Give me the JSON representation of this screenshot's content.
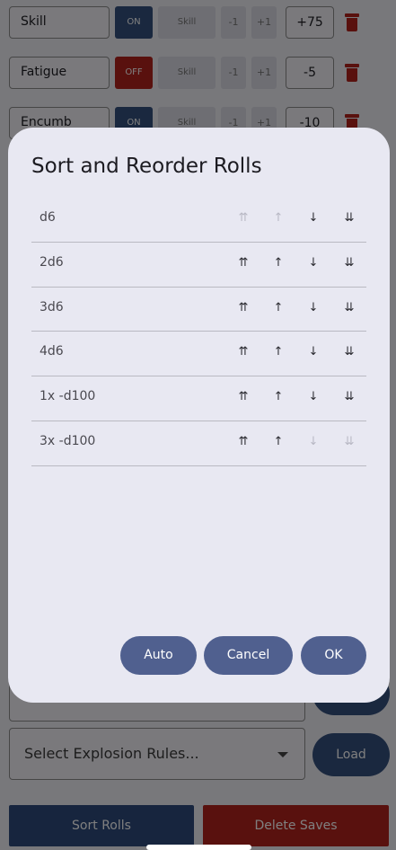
{
  "modifiers": [
    {
      "name": "Skill",
      "toggle": "ON",
      "type": "Skill",
      "minus": "-1",
      "plus": "+1",
      "value": "+75"
    },
    {
      "name": "Fatigue",
      "toggle": "OFF",
      "type": "Skill",
      "minus": "-1",
      "plus": "+1",
      "value": "-5"
    },
    {
      "name": "Encumb",
      "toggle": "ON",
      "type": "Skill",
      "minus": "-1",
      "plus": "+1",
      "value": "-10"
    }
  ],
  "explosion_select": {
    "placeholder": "Select Explosion Rules..."
  },
  "side_buttons": {
    "load": "Load"
  },
  "bottom_buttons": {
    "sort": "Sort Rolls",
    "delete": "Delete Saves"
  },
  "dialog": {
    "title": "Sort and Reorder Rolls",
    "rows": [
      {
        "label": "d6",
        "top_enabled": false,
        "up_enabled": false,
        "down_enabled": true,
        "bottom_enabled": true
      },
      {
        "label": "2d6",
        "top_enabled": true,
        "up_enabled": true,
        "down_enabled": true,
        "bottom_enabled": true
      },
      {
        "label": "3d6",
        "top_enabled": true,
        "up_enabled": true,
        "down_enabled": true,
        "bottom_enabled": true
      },
      {
        "label": "4d6",
        "top_enabled": true,
        "up_enabled": true,
        "down_enabled": true,
        "bottom_enabled": true
      },
      {
        "label": "1x -d100",
        "top_enabled": true,
        "up_enabled": true,
        "down_enabled": true,
        "bottom_enabled": true
      },
      {
        "label": "3x -d100",
        "top_enabled": true,
        "up_enabled": true,
        "down_enabled": false,
        "bottom_enabled": false
      }
    ],
    "icons": {
      "top": "double-arrow-up-icon",
      "up": "arrow-up-icon",
      "down": "arrow-down-icon",
      "bottom": "double-arrow-down-icon"
    },
    "buttons": {
      "auto": "Auto",
      "cancel": "Cancel",
      "ok": "OK"
    }
  },
  "colors": {
    "on": "#35507e",
    "off": "#b3221d",
    "dialog_button": "#50608f",
    "dialog_bg": "#e8e8f2"
  }
}
